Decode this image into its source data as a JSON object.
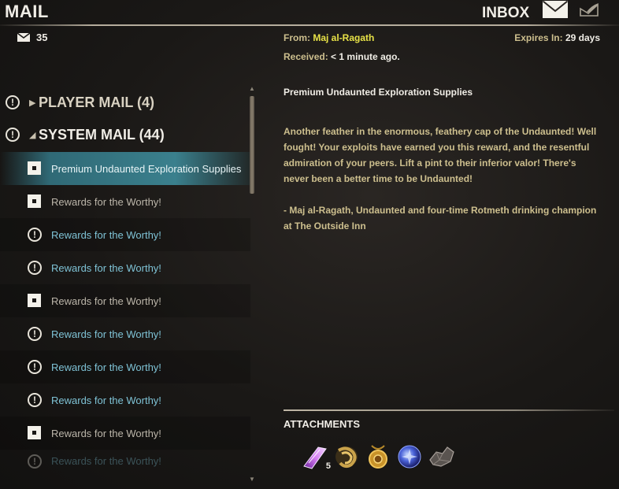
{
  "header": {
    "title": "MAIL",
    "inbox_label": "INBOX",
    "mail_count": "35"
  },
  "categories": {
    "player": {
      "label": "PLAYER MAIL (4)"
    },
    "system": {
      "label": "SYSTEM MAIL (44)"
    }
  },
  "mails": [
    {
      "subject": "Premium Undaunted Exploration Supplies",
      "state": "selected"
    },
    {
      "subject": "Rewards for the Worthy!",
      "state": "read"
    },
    {
      "subject": "Rewards for the Worthy!",
      "state": "unread"
    },
    {
      "subject": "Rewards for the Worthy!",
      "state": "unread"
    },
    {
      "subject": "Rewards for the Worthy!",
      "state": "read"
    },
    {
      "subject": "Rewards for the Worthy!",
      "state": "unread"
    },
    {
      "subject": "Rewards for the Worthy!",
      "state": "unread"
    },
    {
      "subject": "Rewards for the Worthy!",
      "state": "unread"
    },
    {
      "subject": "Rewards for the Worthy!",
      "state": "read"
    },
    {
      "subject": "Rewards for the Worthy!",
      "state": "unread"
    }
  ],
  "detail": {
    "from_label": "From:",
    "sender": "Maj al-Ragath",
    "expires_label": "Expires In:",
    "expires_value": "29 days",
    "received_label": "Received:",
    "received_value": "< 1 minute ago.",
    "subject": "Premium Undaunted Exploration Supplies",
    "body_p1": "Another feather in the enormous, feathery cap of the Undaunted! Well fought! Your exploits have earned you this reward, and the resentful admiration of your peers. Lift a pint to their inferior valor! There's never been a better time to be Undaunted!",
    "body_p2": "- Maj al-Ragath, Undaunted and four-time Rotmeth drinking champion at The Outside Inn"
  },
  "attachments": {
    "title": "ATTACHMENTS",
    "items": [
      {
        "icon": "purple-crystal-icon",
        "qty": "5"
      },
      {
        "icon": "coiled-rope-icon",
        "qty": ""
      },
      {
        "icon": "gold-amulet-icon",
        "qty": ""
      },
      {
        "icon": "blue-orb-icon",
        "qty": ""
      },
      {
        "icon": "ore-chunk-icon",
        "qty": ""
      }
    ]
  },
  "colors": {
    "unread": "#7fc3d6",
    "read": "#bcb6aa",
    "sender": "#e7e247",
    "body": "#cdbf8e"
  }
}
